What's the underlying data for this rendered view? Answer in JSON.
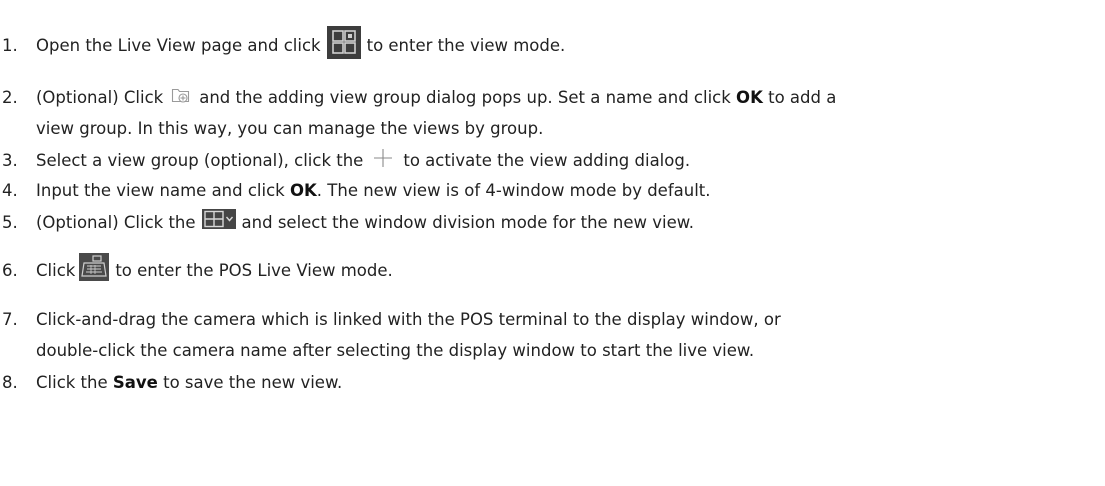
{
  "steps": [
    {
      "number": "1.",
      "before": "Open the Live View page and click",
      "icon": "view-mode-icon",
      "after": "to enter the view mode."
    },
    {
      "number": "2.",
      "before": "(Optional) Click",
      "icon": "add-view-group-icon",
      "after_1": "and the adding view group dialog pops up. Set a name and click",
      "bold": "OK",
      "after_2": "to add a",
      "line2": "view group. In this way, you can manage the views by group."
    },
    {
      "number": "3.",
      "before": "Select a view group (optional), click the",
      "icon": "plus-icon",
      "after": "to activate the view adding dialog."
    },
    {
      "number": "4.",
      "before": "Input the view name and click",
      "bold": "OK",
      "after": ". The new view is of 4-window mode by default."
    },
    {
      "number": "5.",
      "before": "(Optional) Click the",
      "icon": "window-division-icon",
      "after": "and select the window division mode for the new view."
    },
    {
      "number": "6.",
      "before": "Click",
      "icon": "pos-live-view-icon",
      "after": "to enter the POS Live View mode."
    },
    {
      "number": "7.",
      "line1": "Click-and-drag the camera which is linked with the POS terminal to the display window, or",
      "line2": "double-click the camera name after selecting the display window to start the live view."
    },
    {
      "number": "8.",
      "before": "Click the",
      "bold": "Save",
      "after": "to save the new view."
    }
  ],
  "colors": {
    "text": "#222222",
    "icon_dark": "#3d3d3d",
    "icon_light": "#d0d0d0"
  }
}
